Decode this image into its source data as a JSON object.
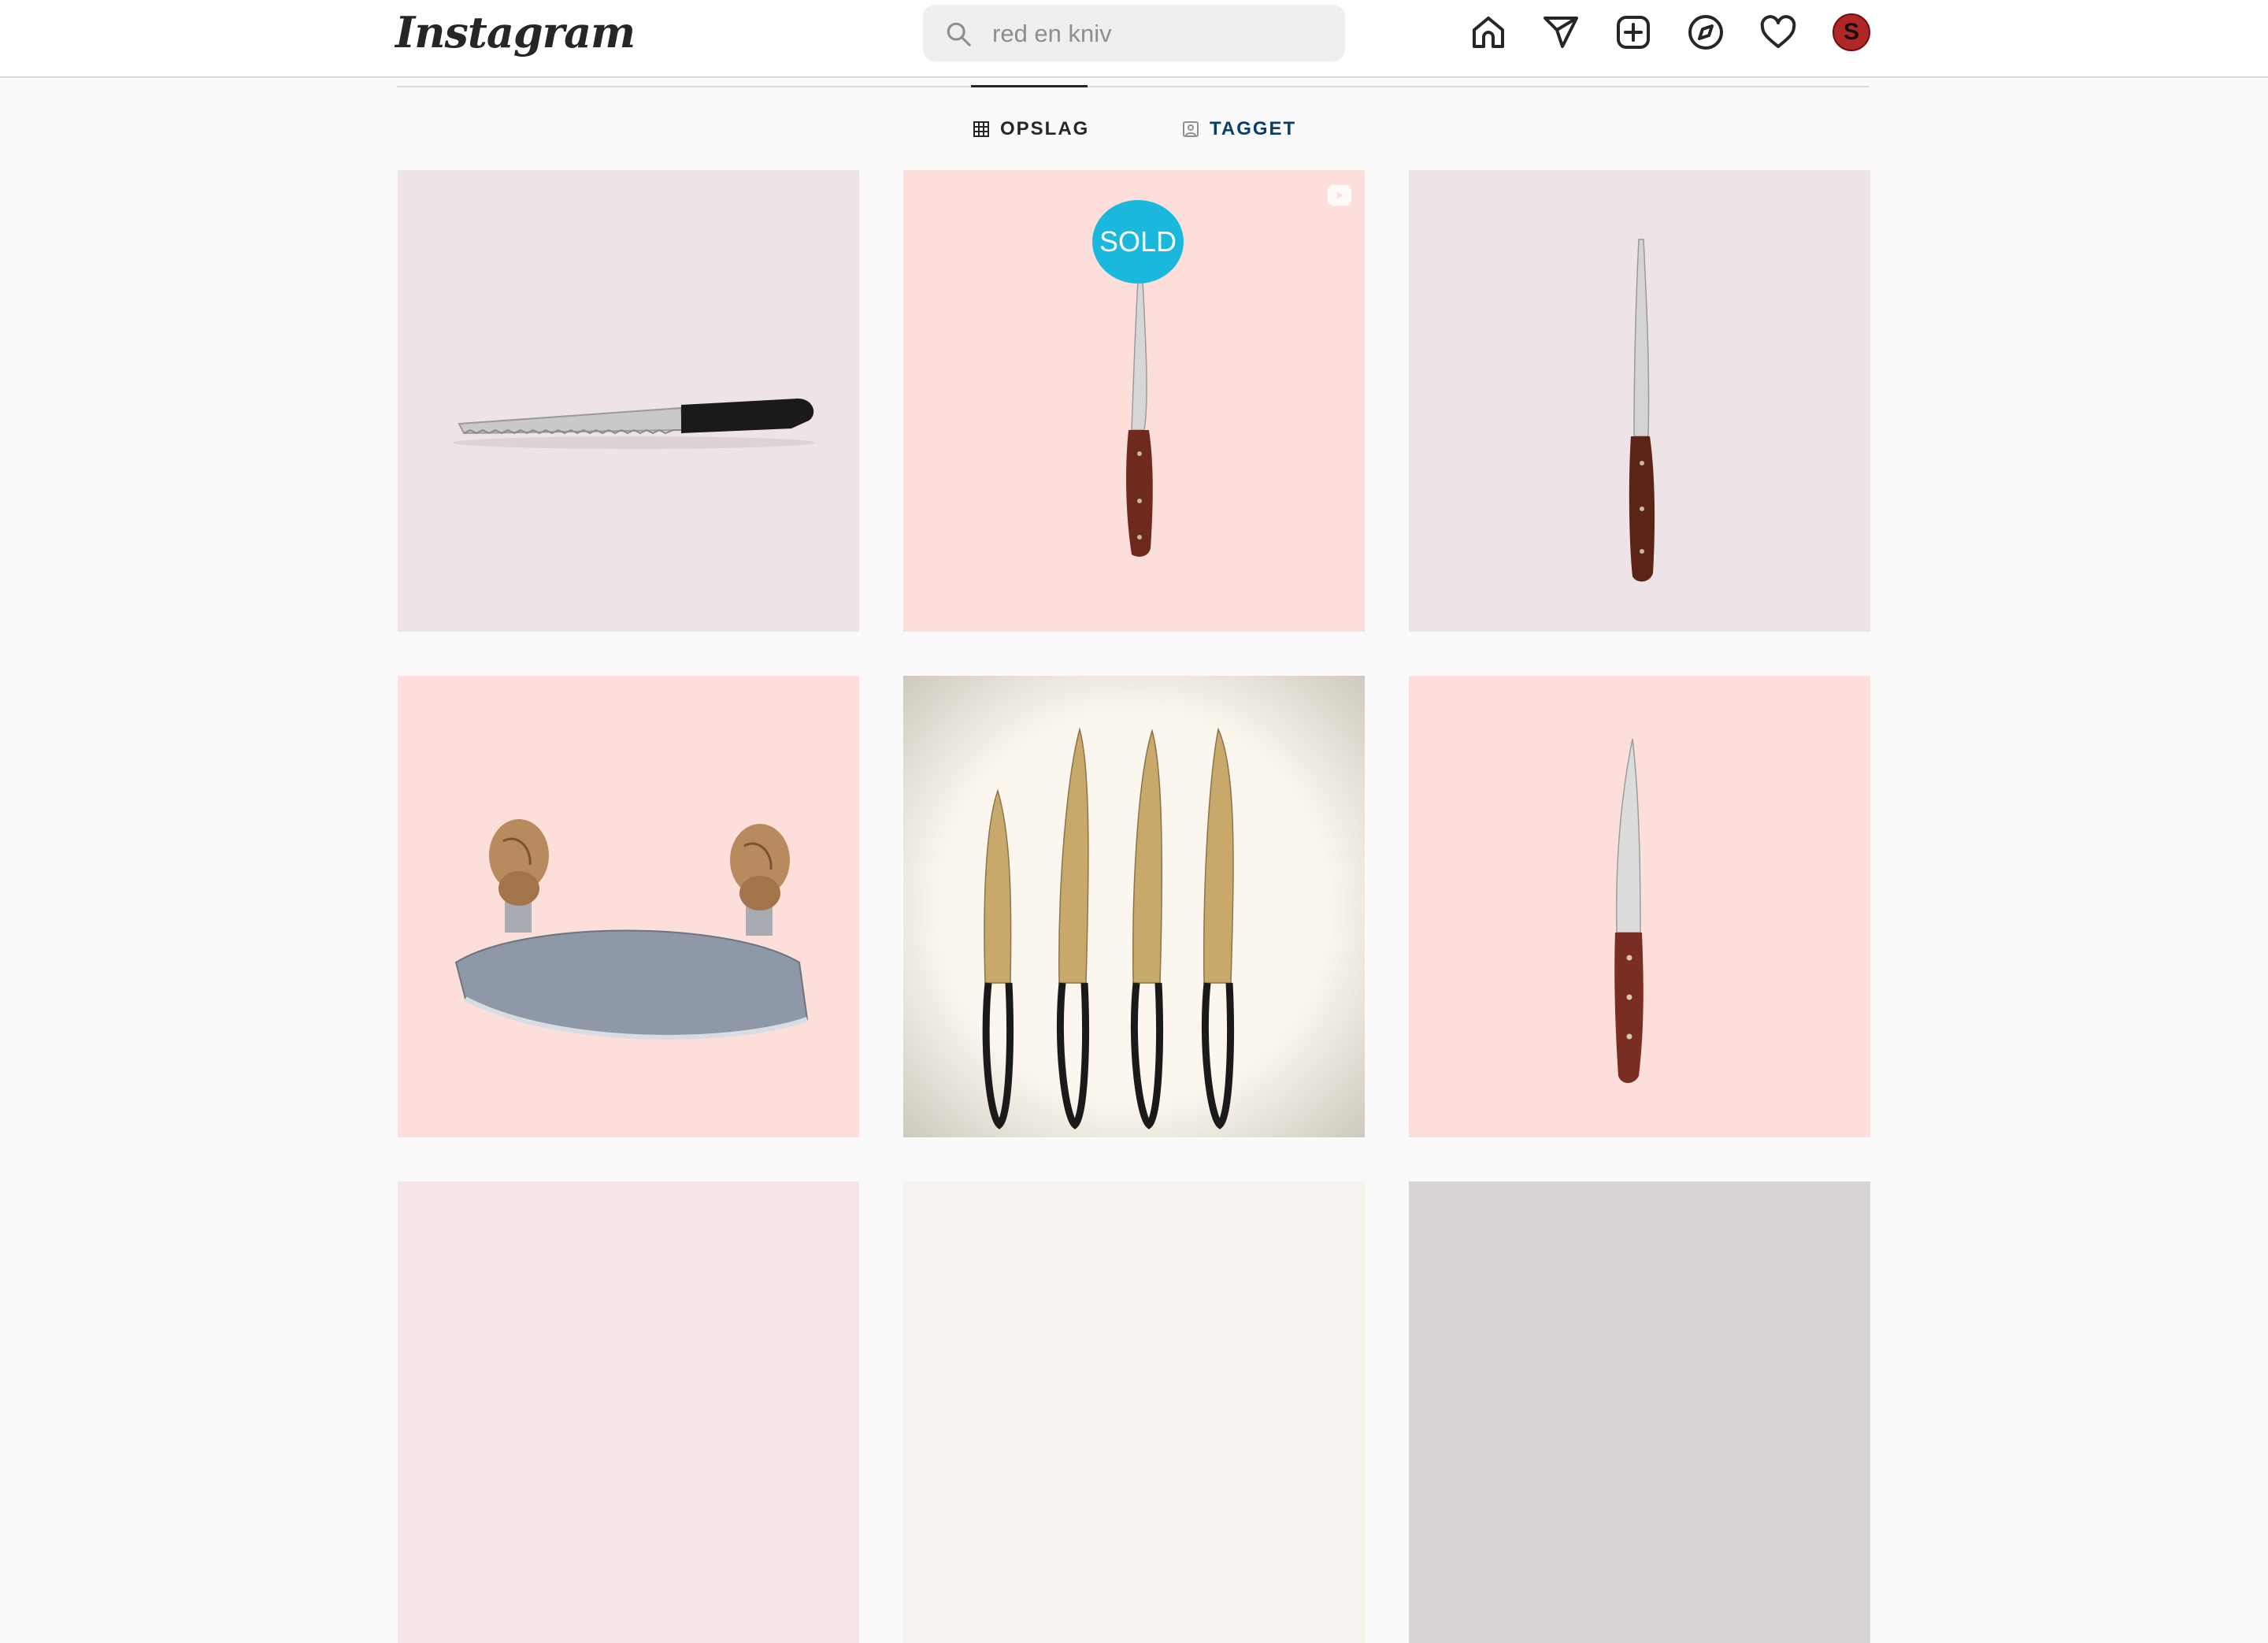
{
  "header": {
    "logo": "Instagram",
    "search_value": "red en kniv",
    "icons": [
      "home-icon",
      "direct-message-icon",
      "new-post-icon",
      "explore-icon",
      "activity-heart-icon"
    ],
    "avatar_letter": "S"
  },
  "tabs": [
    {
      "label": "OPSLAG",
      "icon": "grid-icon",
      "active": true
    },
    {
      "label": "TAGGET",
      "icon": "tagged-icon",
      "active": false
    }
  ],
  "posts": [
    {
      "subject": "bread knife",
      "background": "#eee4e8"
    },
    {
      "subject": "fillet knife",
      "background": "#fcdfda",
      "badge": "SOLD",
      "reel": true
    },
    {
      "subject": "fillet knife",
      "background": "#eee4e8"
    },
    {
      "subject": "mezzaluna",
      "background": "#fcdfda"
    },
    {
      "subject": "four knives",
      "background": "#fbf7ee"
    },
    {
      "subject": "utility knife",
      "background": "#fcdfda"
    }
  ],
  "colors": {
    "accent_tab": "#0b3d66",
    "sold_badge": "#1bb8de",
    "avatar": "#b12727"
  }
}
